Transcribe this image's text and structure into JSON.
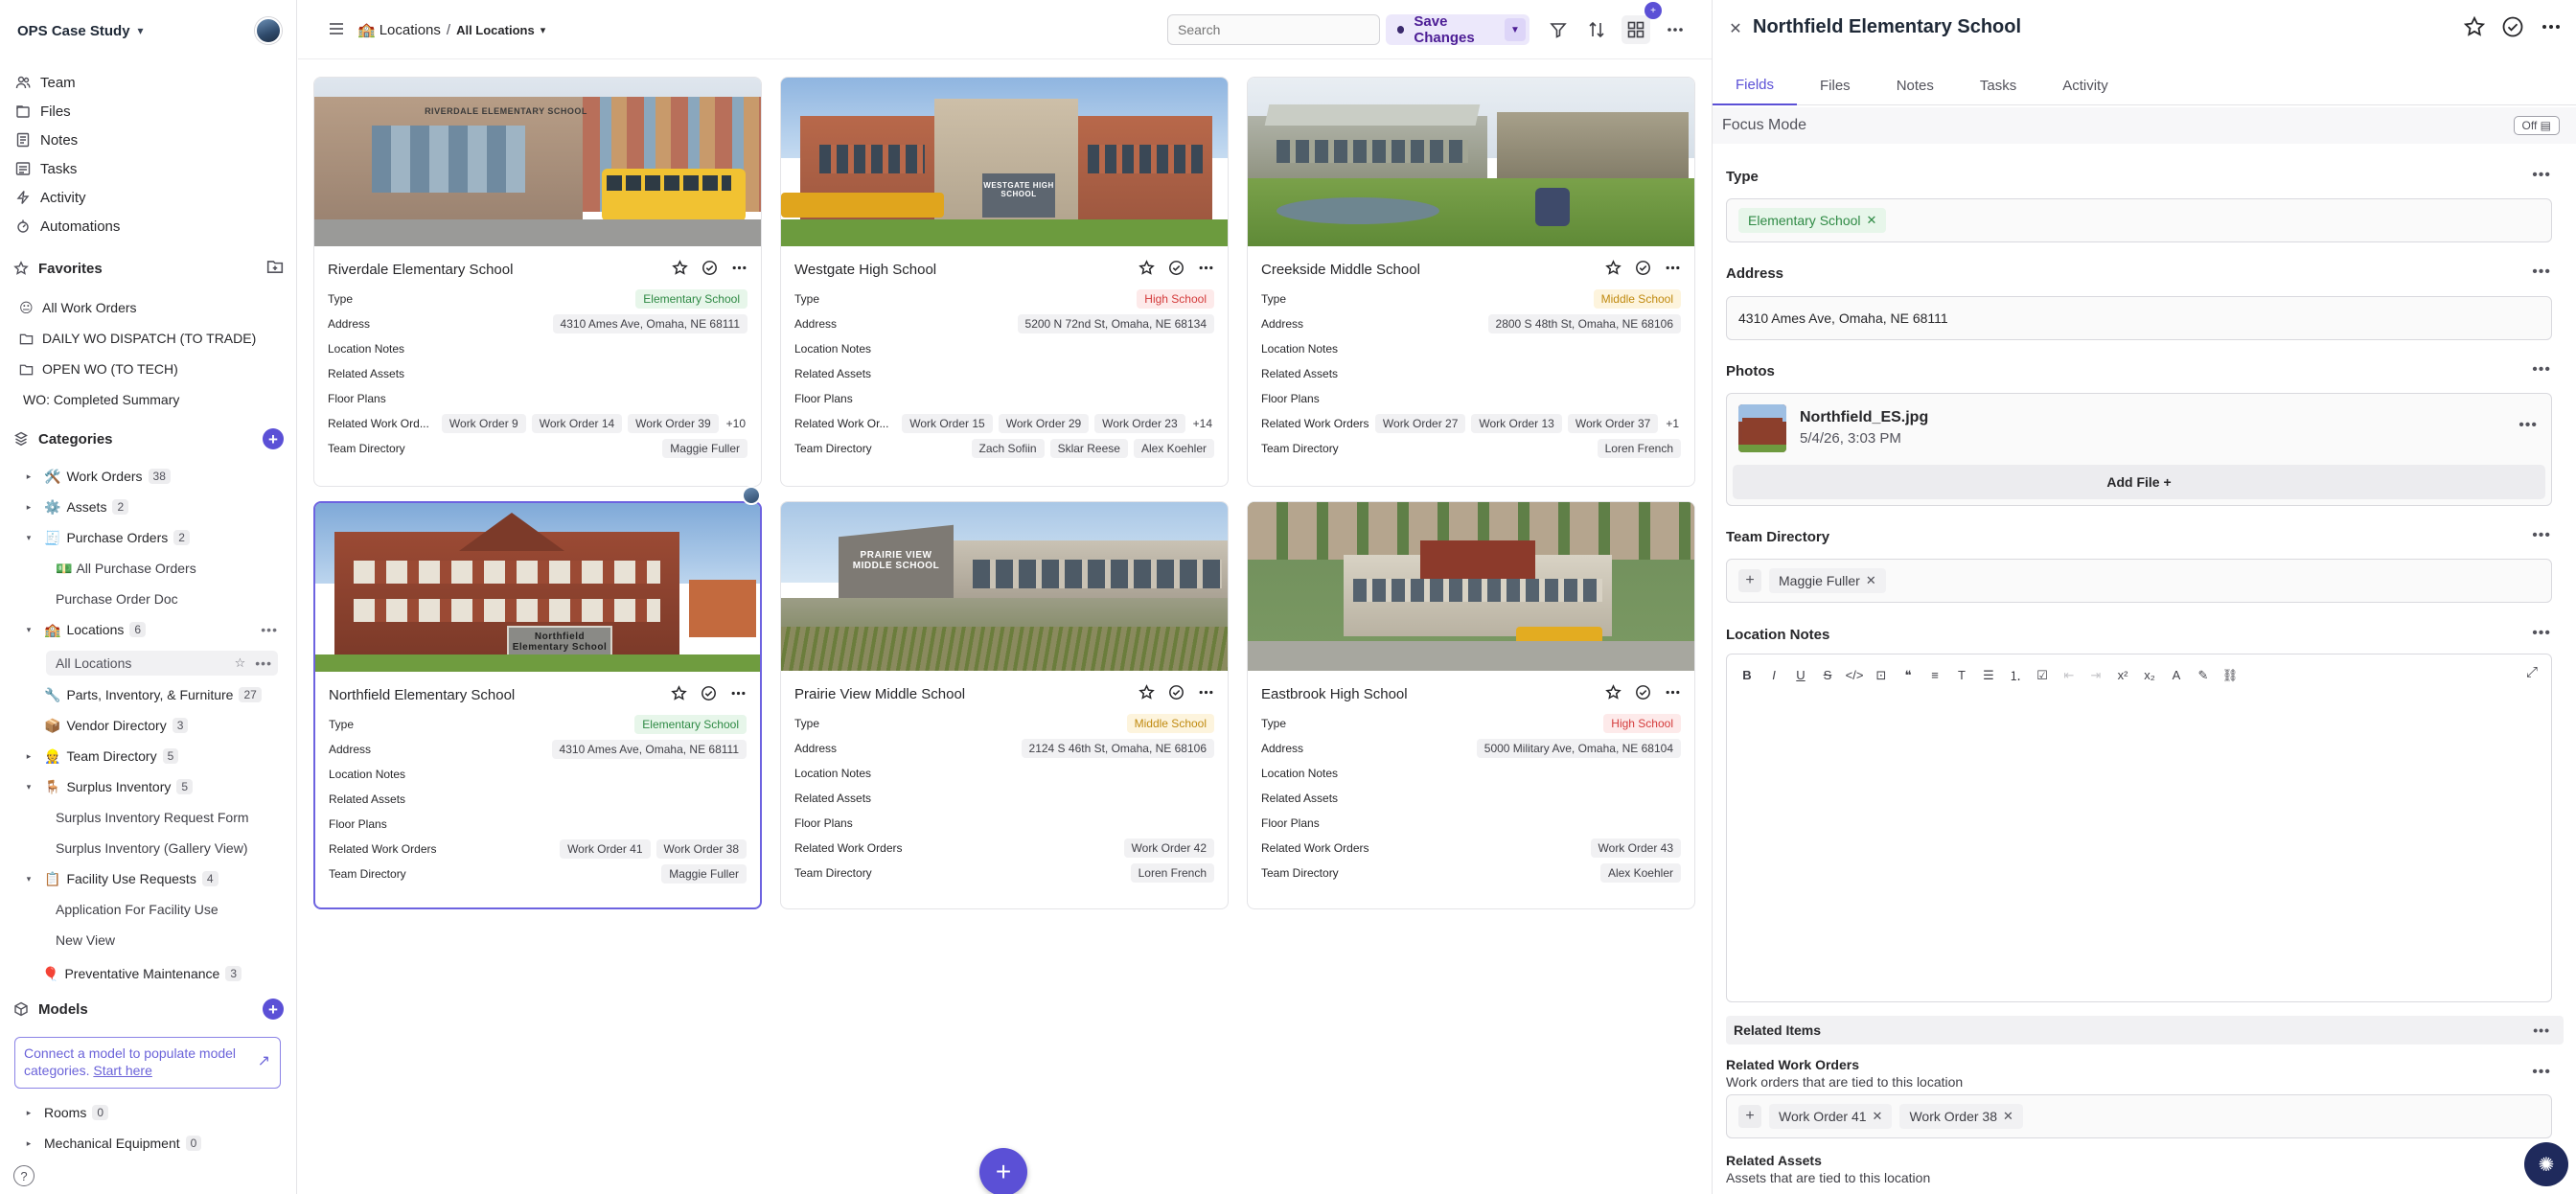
{
  "sidebar": {
    "workspace_name": "OPS Case Study",
    "nav": [
      {
        "label": "Team"
      },
      {
        "label": "Files"
      },
      {
        "label": "Notes"
      },
      {
        "label": "Tasks"
      },
      {
        "label": "Activity"
      },
      {
        "label": "Automations"
      }
    ],
    "favorites_title": "Favorites",
    "favorites": [
      {
        "label": "All Work Orders",
        "icon": "😐"
      },
      {
        "label": "DAILY WO DISPATCH (TO TRADE)",
        "icon": "folder-icon"
      },
      {
        "label": "OPEN WO (TO TECH)",
        "icon": "folder-icon"
      },
      {
        "label": "WO: Completed Summary",
        "icon": ""
      }
    ],
    "categories_title": "Categories",
    "categories": [
      {
        "label": "Work Orders",
        "emoji": "🛠️",
        "count": "38",
        "caret": "▸"
      },
      {
        "label": "Assets",
        "emoji": "⚙️",
        "count": "2",
        "caret": "▸"
      },
      {
        "label": "Purchase Orders",
        "emoji": "🧾",
        "count": "2",
        "caret": "▾"
      },
      {
        "label": "Locations",
        "emoji": "🏫",
        "count": "6",
        "caret": "▾"
      },
      {
        "label": "Parts, Inventory, & Furniture",
        "emoji": "🔧",
        "count": "27",
        "caret": ""
      },
      {
        "label": "Vendor Directory",
        "emoji": "📦",
        "count": "3",
        "caret": ""
      },
      {
        "label": "Team Directory",
        "emoji": "👷",
        "count": "5",
        "caret": "▸"
      },
      {
        "label": "Surplus Inventory",
        "emoji": "🪑",
        "count": "5",
        "caret": "▾"
      },
      {
        "label": "Facility Use Requests",
        "emoji": "📋",
        "count": "4",
        "caret": "▾"
      },
      {
        "label": "Preventative Maintenance",
        "emoji": "🎈",
        "count": "3",
        "caret": ""
      }
    ],
    "subitems": {
      "all_purchase_orders": "All Purchase Orders",
      "all_purchase_orders_emoji": "💵",
      "purchase_order_doc": "Purchase Order Doc",
      "all_locations": "All Locations",
      "surplus_request_form": "Surplus Inventory Request Form",
      "surplus_gallery": "Surplus Inventory (Gallery View)",
      "application_facility": "Application For Facility Use",
      "new_view": "New View"
    },
    "models_title": "Models",
    "connect_text": "Connect a model to populate model categories.",
    "connect_link": "Start here",
    "models": [
      {
        "label": "Rooms",
        "count": "0"
      },
      {
        "label": "Mechanical Equipment",
        "count": "0"
      }
    ],
    "help": "?"
  },
  "topbar": {
    "breadcrumb_root": "Locations",
    "breadcrumb_sep": "/",
    "breadcrumb_current": "All Locations",
    "search_placeholder": "Search",
    "save_label": "Save Changes",
    "badge": "+"
  },
  "gallery": {
    "field_labels": {
      "type": "Type",
      "address": "Address",
      "location_notes": "Location Notes",
      "related_assets": "Related Assets",
      "floor_plans": "Floor Plans",
      "related_work_orders": "Related Work Orders",
      "related_work_orders_short": "Related Work Ord...",
      "related_work_orders_short2": "Related Work Or...",
      "team_directory": "Team Directory"
    },
    "cards": [
      {
        "title": "Riverdale Elementary School",
        "type": "Elementary School",
        "address": "4310 Ames Ave, Omaha, NE 68111",
        "work_orders": [
          "Work Order 9",
          "Work Order 14",
          "Work Order 39"
        ],
        "wo_more": "+10",
        "team": [
          "Maggie Fuller"
        ],
        "sign": "RIVERDALE ELEMENTARY SCHOOL"
      },
      {
        "title": "Westgate High School",
        "type": "High School",
        "address": "5200 N 72nd St, Omaha, NE 68134",
        "work_orders": [
          "Work Order 15",
          "Work Order 29",
          "Work Order 23"
        ],
        "wo_more": "+14",
        "team": [
          "Zach Sofiin",
          "Sklar Reese",
          "Alex Koehler"
        ],
        "sign": "WESTGATE HIGH SCHOOL"
      },
      {
        "title": "Creekside Middle School",
        "type": "Middle School",
        "address": "2800 S 48th St, Omaha, NE 68106",
        "work_orders": [
          "Work Order 27",
          "Work Order 13",
          "Work Order 37"
        ],
        "wo_more": "+1",
        "team": [
          "Loren French"
        ],
        "sign": ""
      },
      {
        "title": "Northfield Elementary School",
        "type": "Elementary School",
        "address": "4310 Ames Ave, Omaha, NE 68111",
        "work_orders": [
          "Work Order 41",
          "Work Order 38"
        ],
        "wo_more": "",
        "team": [
          "Maggie Fuller"
        ],
        "sign": "Northfield Elementary School"
      },
      {
        "title": "Prairie View Middle School",
        "type": "Middle School",
        "address": "2124 S 46th St, Omaha, NE 68106",
        "work_orders": [
          "Work Order 42"
        ],
        "wo_more": "",
        "team": [
          "Loren French"
        ],
        "sign": "PRAIRIE VIEW MIDDLE SCHOOL"
      },
      {
        "title": "Eastbrook High School",
        "type": "High School",
        "address": "5000 Military Ave, Omaha, NE 68104",
        "work_orders": [
          "Work Order 43"
        ],
        "wo_more": "",
        "team": [
          "Alex Koehler"
        ],
        "sign": ""
      }
    ]
  },
  "detail": {
    "title": "Northfield Elementary School",
    "tabs": [
      "Fields",
      "Files",
      "Notes",
      "Tasks",
      "Activity"
    ],
    "focus_mode": "Focus Mode",
    "focus_toggle": "Off",
    "type_label": "Type",
    "type_value": "Elementary School",
    "address_label": "Address",
    "address_value": "4310 Ames Ave, Omaha, NE 68111",
    "photos_label": "Photos",
    "photo_file_name": "Northfield_ES.jpg",
    "photo_file_date": "5/4/26, 3:03 PM",
    "add_file": "Add File +",
    "team_label": "Team Directory",
    "team_value": "Maggie Fuller",
    "notes_label": "Location Notes",
    "related_items": "Related Items",
    "related_wo_title": "Related Work Orders",
    "related_wo_sub": "Work orders that are tied to this location",
    "related_wo": [
      "Work Order 41",
      "Work Order 38"
    ],
    "related_assets_title": "Related Assets",
    "related_assets_sub": "Assets that are tied to this location"
  }
}
